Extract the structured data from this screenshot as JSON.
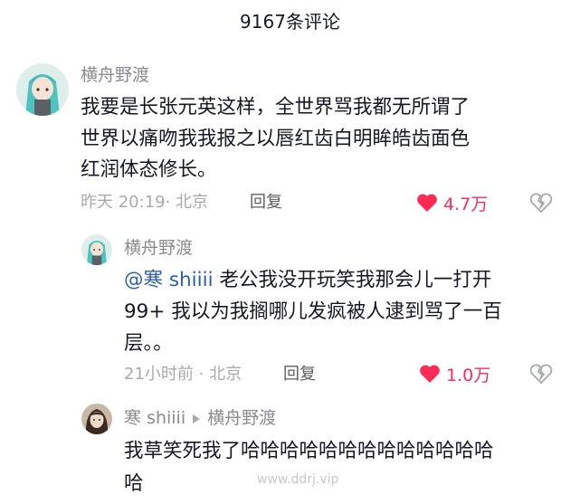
{
  "header": {
    "title": "9167条评论"
  },
  "colors": {
    "like_red": "#fe2c55",
    "mention_blue": "#2b5fa8",
    "meta_gray": "#a9aaae",
    "name_gray": "#8a8b91"
  },
  "comments": [
    {
      "author": "横舟野渡",
      "avatar_icon": "anime-avatar-icon",
      "lines": [
        "我要是长张元英这样，全世界骂我都无所谓了",
        "世界以痛吻我我报之以唇红齿白明眸皓齿面色",
        "红润体态修长。"
      ],
      "time_location": "昨天 20:19· 北京",
      "reply_label": "回复",
      "like_count": "4.7万"
    },
    {
      "author": "横舟野渡",
      "avatar_icon": "anime-avatar-icon",
      "mention": "@寒 shiiii",
      "lines": [
        " 老公我没开玩笑我那会儿一打开",
        "99+ 我以为我搁哪儿发疯被人逮到骂了一百",
        "层。。"
      ],
      "time_location": "21小时前 · 北京",
      "reply_label": "回复",
      "like_count": "1.0万"
    },
    {
      "author": "寒 shiiii",
      "reply_to": "横舟野渡",
      "avatar_icon": "girl-avatar-icon",
      "lines": [
        "我草笑死我了哈哈哈哈哈哈哈哈哈哈哈哈哈",
        "哈"
      ]
    }
  ],
  "watermark": "www.ddrj.vip"
}
